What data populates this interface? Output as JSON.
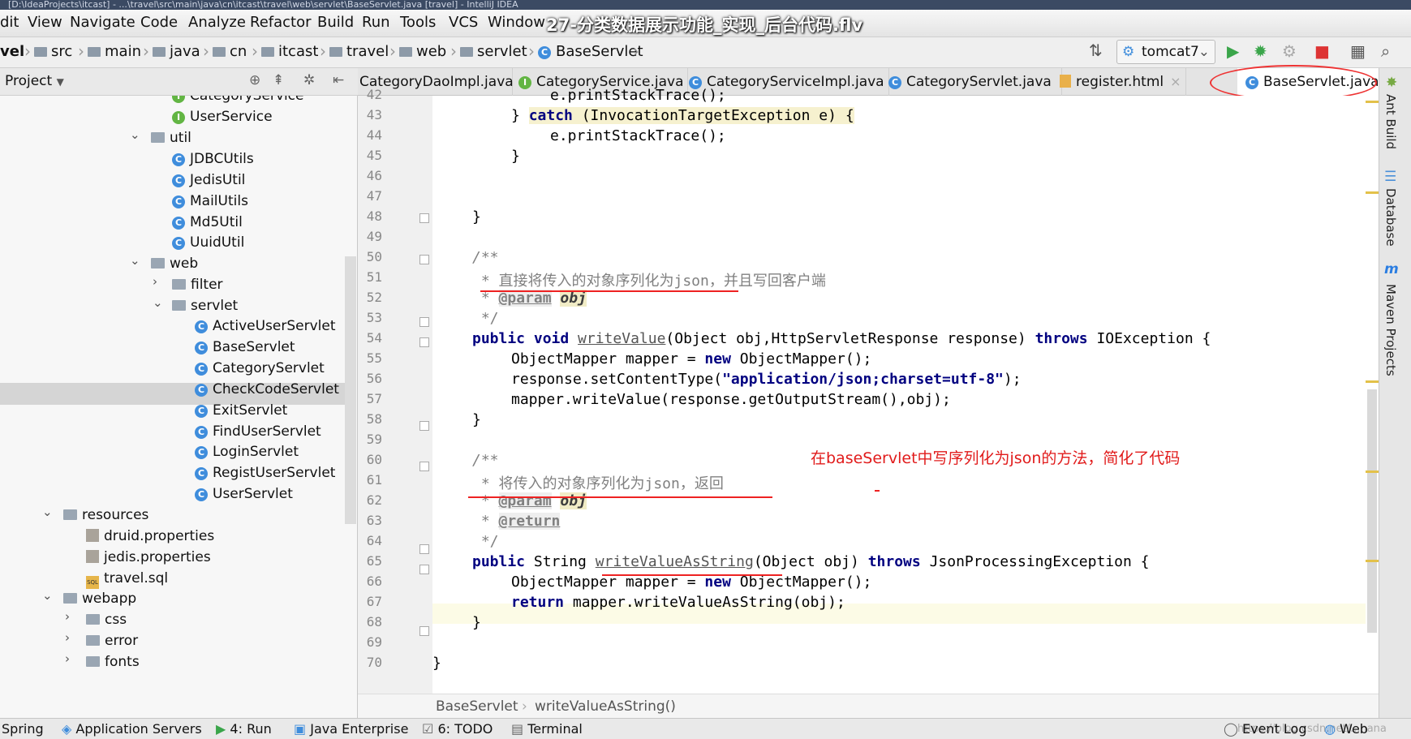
{
  "window": {
    "title": "[D:\\IdeaProjects\\itcast] - ...\\travel\\src\\main\\java\\cn\\itcast\\travel\\web\\servlet\\BaseServlet.java [travel] - IntelliJ IDEA",
    "video_title": "27-分类数据展示功能_实现_后台代码.flv"
  },
  "menu": [
    "dit",
    "View",
    "Navigate",
    "Code",
    "Analyze",
    "Refactor",
    "Build",
    "Run",
    "Tools",
    "VCS",
    "Window"
  ],
  "breadcrumb": [
    "vel",
    "src",
    "main",
    "java",
    "cn",
    "itcast",
    "travel",
    "web",
    "servlet",
    "BaseServlet"
  ],
  "toolbar": {
    "run_config": "tomcat7"
  },
  "project": {
    "header": "Project",
    "tree": [
      "CategoryService",
      "UserService",
      "util",
      "JDBCUtils",
      "JedisUtil",
      "MailUtils",
      "Md5Util",
      "UuidUtil",
      "web",
      "filter",
      "servlet",
      "ActiveUserServlet",
      "BaseServlet",
      "CategoryServlet",
      "CheckCodeServlet",
      "ExitServlet",
      "FindUserServlet",
      "LoginServlet",
      "RegistUserServlet",
      "UserServlet",
      "resources",
      "druid.properties",
      "jedis.properties",
      "travel.sql",
      "webapp",
      "css",
      "error",
      "fonts"
    ]
  },
  "tabs": [
    "CategoryDaoImpl.java",
    "CategoryService.java",
    "CategoryServiceImpl.java",
    "CategoryServlet.java",
    "register.html",
    "BaseServlet.java"
  ],
  "editor": {
    "line_numbers": [
      "42",
      "43",
      "44",
      "45",
      "46",
      "47",
      "48",
      "49",
      "50",
      "51",
      "52",
      "53",
      "54",
      "55",
      "56",
      "57",
      "58",
      "59",
      "60",
      "61",
      "62",
      "63",
      "64",
      "65",
      "66",
      "67",
      "68",
      "69",
      "70"
    ],
    "lines": {
      "l42": "e.printStackTrace();",
      "l43a": "} ",
      "l43kw": "catch",
      "l43b": " (InvocationTargetException e) {",
      "l44": "e.printStackTrace();",
      "l45": "}",
      "l48": "}",
      "l50": "/**",
      "l51": " * 直接将传入的对象序列化为json，并且写回客户端",
      "l52a": " * ",
      "l52tag": "@param",
      "l52p": "obj",
      "l53": " */",
      "l54kw1": "public void ",
      "l54m": "writeValue",
      "l54a": "(Object obj,HttpServletResponse response) ",
      "l54kw2": "throws",
      "l54b": " IOException {",
      "l55a": "ObjectMapper mapper = ",
      "l55kw": "new",
      "l55b": " ObjectMapper();",
      "l56a": "response.setContentType(",
      "l56s": "\"application/json;charset=utf-8\"",
      "l56b": ");",
      "l57": "mapper.writeValue(response.getOutputStream(),obj);",
      "l58": "}",
      "l60": "/**",
      "l61": " * 将传入的对象序列化为json，返回",
      "l62a": " * ",
      "l62tag": "@param",
      "l62p": "obj",
      "l63a": " * ",
      "l63tag": "@return",
      "l64": " */",
      "l65kw": "public",
      "l65a": " String ",
      "l65m": "writeValueAsString",
      "l65b": "(Object obj) ",
      "l65kw2": "throws",
      "l65c": " JsonProcessingException {",
      "l66a": "ObjectMapper mapper = ",
      "l66kw": "new",
      "l66b": " ObjectMapper();",
      "l67kw": "return",
      "l67a": " mapper.writeValueAsString(obj);",
      "l68": "}",
      "l70": "}"
    },
    "annotation": "在baseServlet中写序列化为json的方法，简化了代码",
    "crumbs": [
      "BaseServlet",
      "writeValueAsString()"
    ]
  },
  "right_tools": [
    "Ant Build",
    "Database",
    "Maven Projects"
  ],
  "statusbar": {
    "items": [
      "Spring",
      "Application Servers",
      "4: Run",
      "Java Enterprise",
      "6: TODO",
      "Terminal"
    ],
    "right": [
      "Event Log",
      "Web"
    ],
    "watermark": "https://blog.csdn.net/...hana"
  }
}
